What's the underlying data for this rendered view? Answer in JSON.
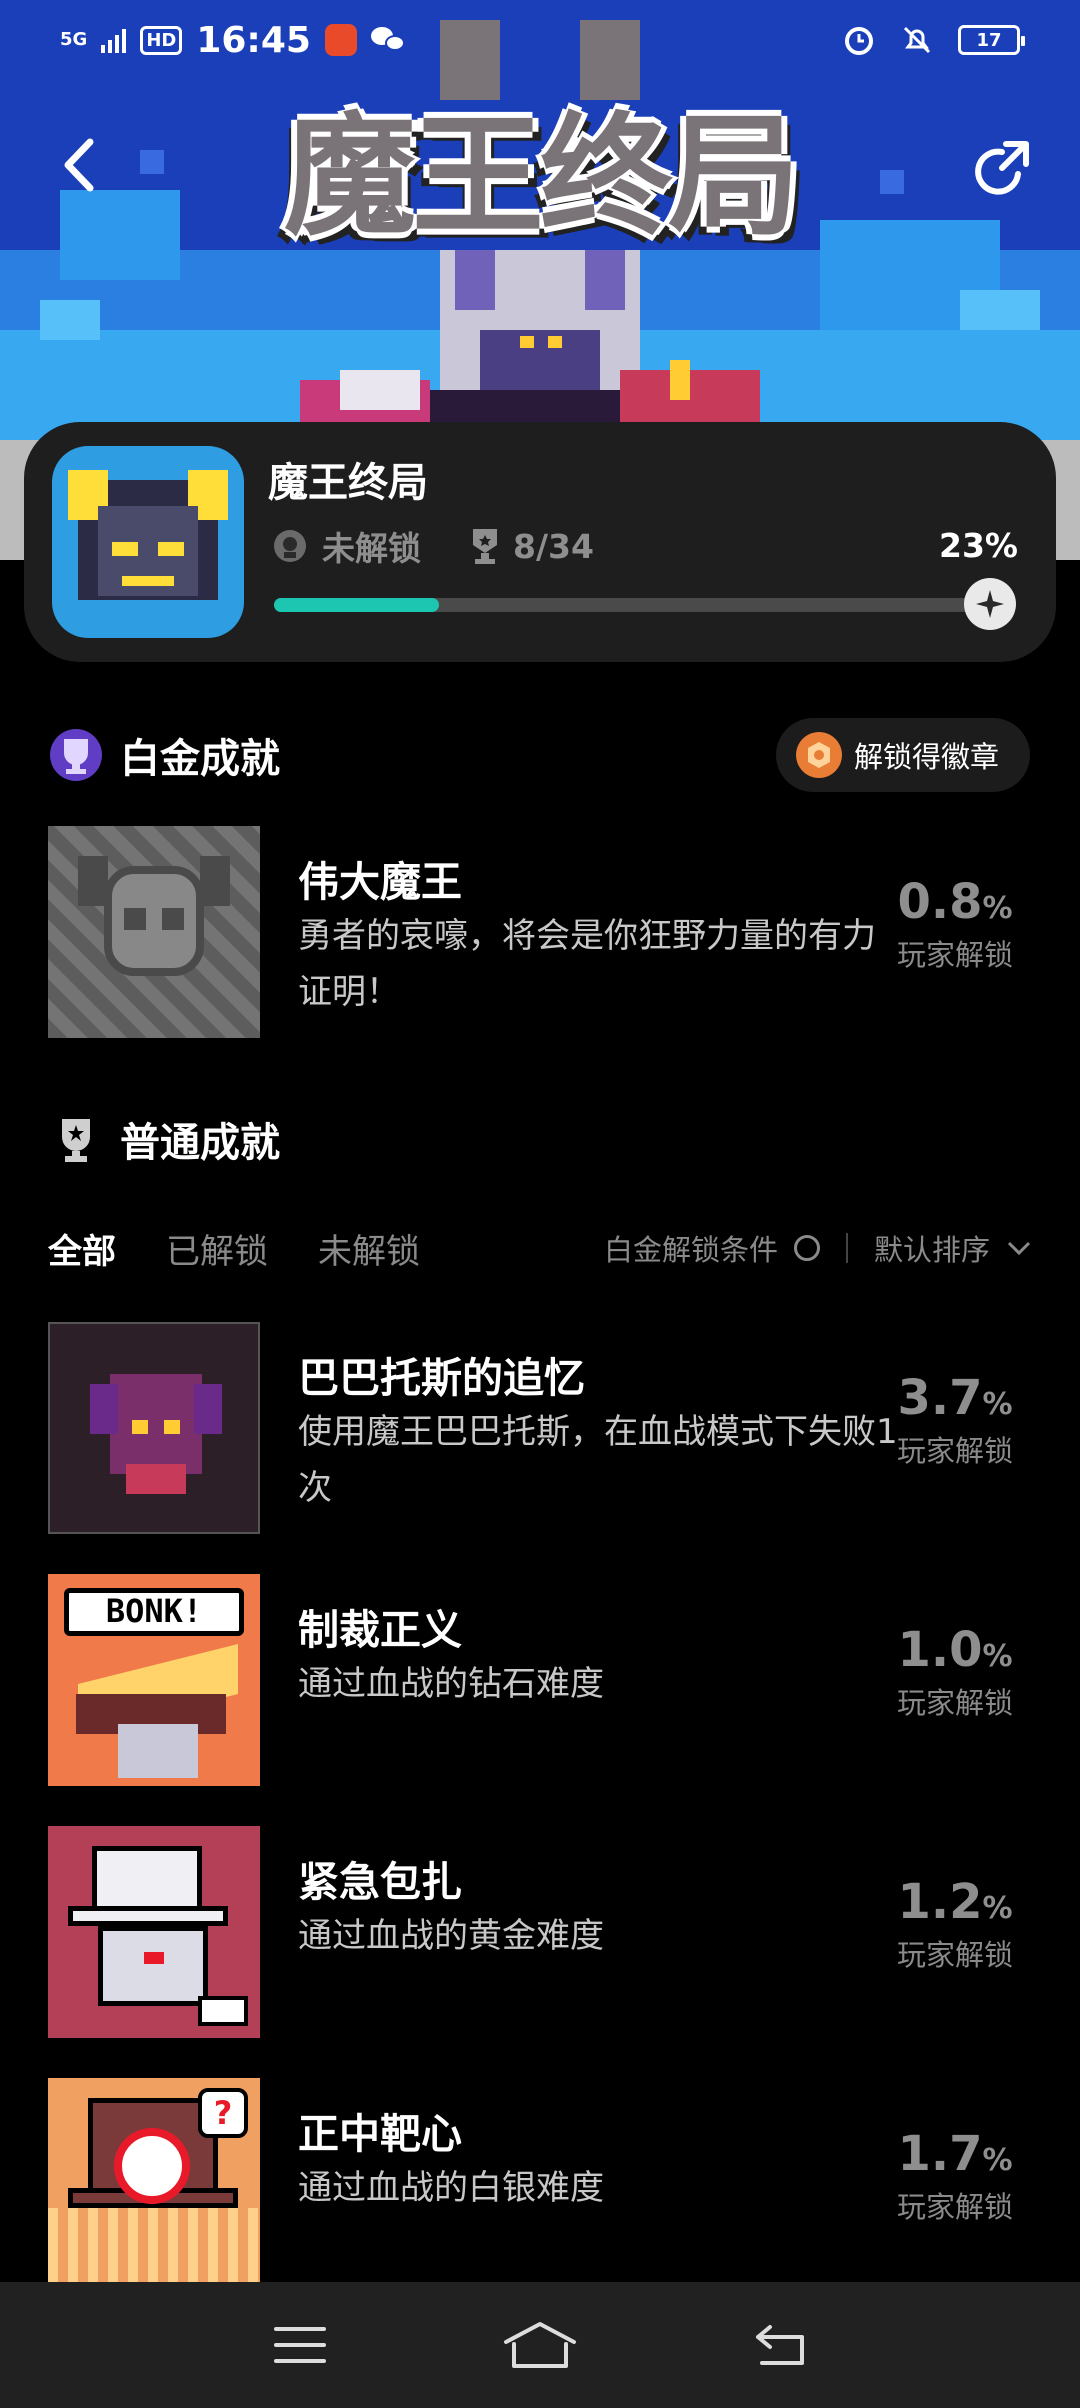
{
  "status_bar": {
    "signal": "5G",
    "hd": "HD",
    "time": "16:45",
    "battery": "17"
  },
  "hero": {
    "logo_text": "魔王终局"
  },
  "game": {
    "title": "魔王终局",
    "status": "未解锁",
    "progress_text": "8/34",
    "percent_text": "23%",
    "progress": 0.23
  },
  "platinum": {
    "title": "白金成就",
    "badge_button": "解锁得徽章",
    "item": {
      "name": "伟大魔王",
      "desc": "勇者的哀嚎，将会是你狂野力量的有力证明！",
      "rate": "0.8",
      "unit": "%",
      "label": "玩家解锁"
    }
  },
  "normal": {
    "title": "普通成就",
    "tabs": [
      "全部",
      "已解锁",
      "未解锁"
    ],
    "platinum_condition": "白金解锁条件",
    "sort": "默认排序",
    "items": [
      {
        "name": "巴巴托斯的追忆",
        "desc": "使用魔王巴巴托斯，在血战模式下失败1次",
        "rate": "3.7",
        "unit": "%",
        "label": "玩家解锁"
      },
      {
        "name": "制裁正义",
        "desc": "通过血战的钻石难度",
        "rate": "1.0",
        "unit": "%",
        "label": "玩家解锁",
        "art_text": "BONK!"
      },
      {
        "name": "紧急包扎",
        "desc": "通过血战的黄金难度",
        "rate": "1.2",
        "unit": "%",
        "label": "玩家解锁"
      },
      {
        "name": "正中靶心",
        "desc": "通过血战的白银难度",
        "rate": "1.7",
        "unit": "%",
        "label": "玩家解锁"
      }
    ]
  },
  "colors": {
    "accent": "#1cc6b1",
    "hero_blue": "#1c47c8",
    "card_bg": "#1e1e1e"
  }
}
